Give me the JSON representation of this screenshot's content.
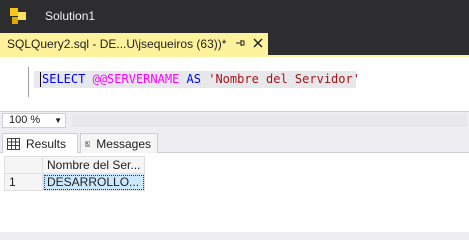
{
  "window": {
    "title": "Solution1"
  },
  "document_tab": {
    "label": "SQLQuery2.sql - DE...U\\jsequeiros (63))*"
  },
  "editor": {
    "query": {
      "keyword_select": "SELECT",
      "function": "@@SERVERNAME",
      "keyword_as": "AS",
      "string_literal": "'Nombre del Servidor'"
    }
  },
  "zoom": {
    "value": "100 %"
  },
  "results_tabs": [
    {
      "label": "Results",
      "icon": "grid-icon",
      "active": true
    },
    {
      "label": "Messages",
      "icon": "messages-icon",
      "active": false
    }
  ],
  "results_grid": {
    "columns": [
      "Nombre del Ser..."
    ],
    "rows": [
      {
        "row_number": "1",
        "cells": [
          "DESARROLLO..."
        ]
      }
    ]
  },
  "colors": {
    "titlebar": "#2d2d30",
    "active_tab": "#fff29d",
    "keyword": "#0000ff",
    "function": "#ff00ff",
    "string": "#a31515",
    "selected_cell": "#cce8ff"
  }
}
